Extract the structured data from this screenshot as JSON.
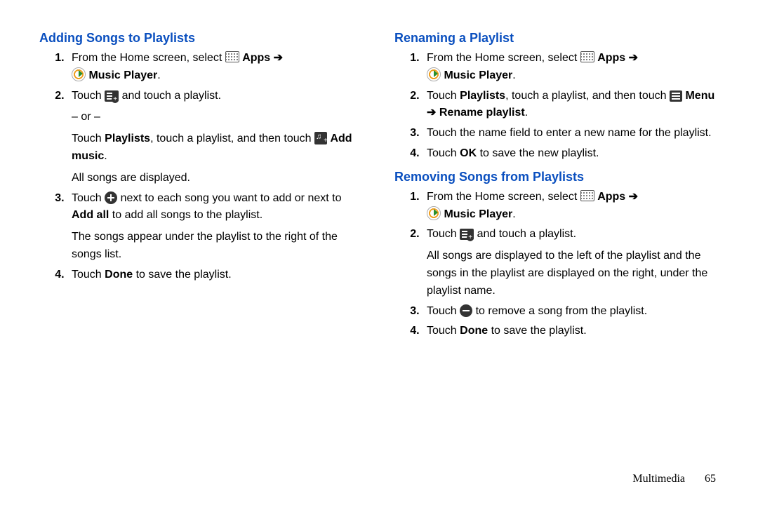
{
  "left": {
    "heading": "Adding Songs to Playlists",
    "step1_a": "From the Home screen, select ",
    "apps_label": " Apps",
    "arrow": " ➔ ",
    "music_label": " Music Player",
    "period": ".",
    "step2_a": "Touch ",
    "step2_b": " and touch a playlist.",
    "step2_or": "– or –",
    "step2_c1": "Touch ",
    "step2_c_playlists": "Playlists",
    "step2_c2": ", touch a playlist, and then touch ",
    "addmusic_label": " Add music",
    "step2_d": "All songs are displayed.",
    "step3_a": "Touch ",
    "step3_b": " next to each song you want to add or next to ",
    "step3_addall": "Add all",
    "step3_c": " to add all songs to the playlist.",
    "step3_d": "The songs appear under the playlist to the right of the songs list.",
    "step4_a": "Touch ",
    "step4_done": "Done",
    "step4_b": " to save the playlist."
  },
  "right": {
    "h1": "Renaming a Playlist",
    "r1_step1_a": "From the Home screen, select ",
    "r1_step2_a": "Touch ",
    "r1_step2_playlists": "Playlists",
    "r1_step2_b": ", touch a playlist, and then touch ",
    "menu_label": " Menu",
    "rename_label": "Rename playlist",
    "r1_step3": "Touch the name field to enter a new name for the playlist.",
    "r1_step4_a": "Touch ",
    "r1_step4_ok": "OK",
    "r1_step4_b": " to save the new playlist.",
    "h2": "Removing Songs from Playlists",
    "r2_step1_a": "From the Home screen, select ",
    "r2_step2_a": "Touch ",
    "r2_step2_b": " and touch a playlist.",
    "r2_step2_c": "All songs are displayed to the left of the playlist and the songs in the playlist are displayed on the right, under the playlist name.",
    "r2_step3_a": "Touch ",
    "r2_step3_b": " to remove a song from the playlist.",
    "r2_step4_a": "Touch ",
    "r2_step4_done": "Done",
    "r2_step4_b": " to save the playlist."
  },
  "footer": {
    "section": "Multimedia",
    "page": "65"
  },
  "arrow_glyph": " ➔ "
}
